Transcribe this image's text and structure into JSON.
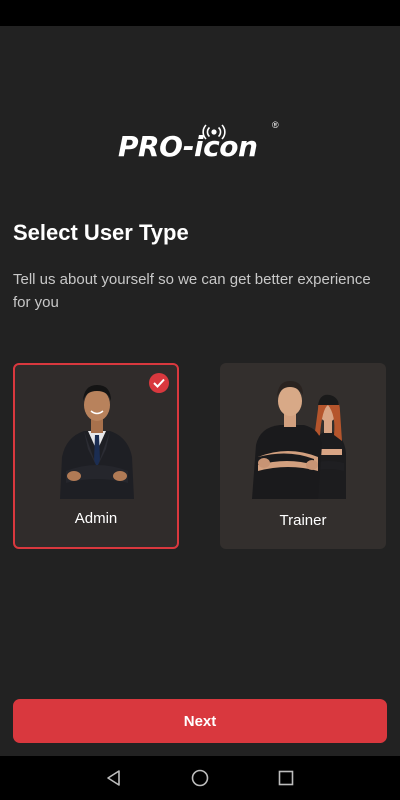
{
  "logo": {
    "text": "PRO-icon",
    "registered": "®"
  },
  "page": {
    "title": "Select User Type",
    "subtitle": "Tell us about yourself so we can get better experience for you"
  },
  "user_types": [
    {
      "label": "Admin",
      "selected": true
    },
    {
      "label": "Trainer",
      "selected": false
    }
  ],
  "next_label": "Next",
  "colors": {
    "accent": "#d9383e",
    "background": "#222222",
    "card": "#332f2d"
  },
  "nav": {
    "icons": [
      "back-icon",
      "home-icon",
      "recents-icon"
    ]
  }
}
